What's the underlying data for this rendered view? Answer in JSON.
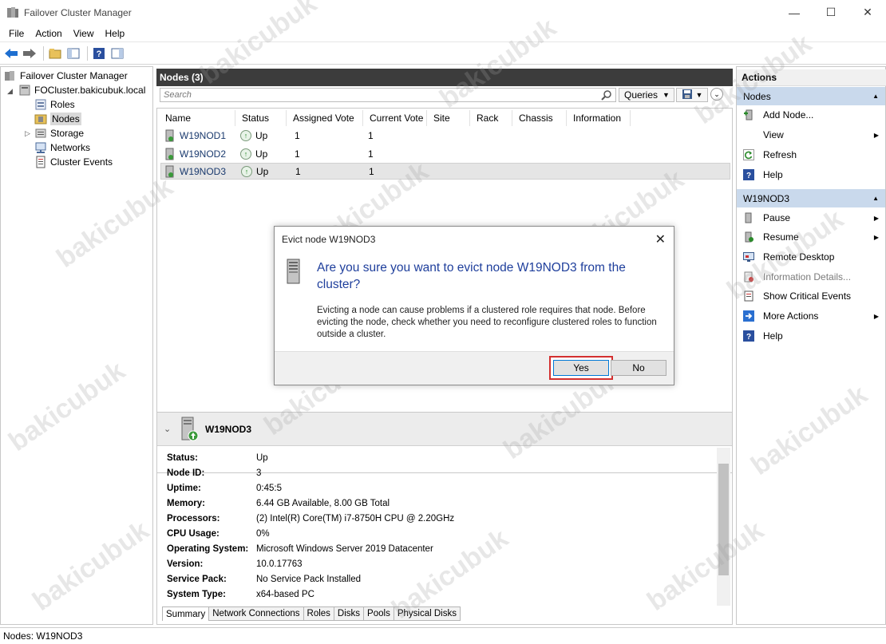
{
  "window": {
    "title": "Failover Cluster Manager",
    "minimize": "—",
    "maximize": "☐",
    "close": "✕"
  },
  "menu": [
    "File",
    "Action",
    "View",
    "Help"
  ],
  "tree": {
    "root": "Failover Cluster Manager",
    "cluster": "FOCluster.bakicubuk.local",
    "items": [
      "Roles",
      "Nodes",
      "Storage",
      "Networks",
      "Cluster Events"
    ]
  },
  "center": {
    "header": "Nodes (3)",
    "search_placeholder": "Search",
    "queries_label": "Queries",
    "columns": [
      "Name",
      "Status",
      "Assigned Vote",
      "Current Vote",
      "Site",
      "Rack",
      "Chassis",
      "Information"
    ],
    "rows": [
      {
        "name": "W19NOD1",
        "status": "Up",
        "assigned_vote": "1",
        "current_vote": "1"
      },
      {
        "name": "W19NOD2",
        "status": "Up",
        "assigned_vote": "1",
        "current_vote": "1"
      },
      {
        "name": "W19NOD3",
        "status": "Up",
        "assigned_vote": "1",
        "current_vote": "1"
      }
    ]
  },
  "details": {
    "title": "W19NOD3",
    "props": [
      {
        "k": "Status:",
        "v": "Up"
      },
      {
        "k": "Node ID:",
        "v": "3"
      },
      {
        "k": "Uptime:",
        "v": "0:45:5"
      },
      {
        "k": "Memory:",
        "v": "6.44 GB Available, 8.00 GB Total"
      },
      {
        "k": "Processors:",
        "v": "(2) Intel(R) Core(TM) i7-8750H CPU @ 2.20GHz"
      },
      {
        "k": "CPU Usage:",
        "v": "0%"
      },
      {
        "k": "Operating System:",
        "v": "Microsoft Windows Server 2019 Datacenter"
      },
      {
        "k": "Version:",
        "v": "10.0.17763"
      },
      {
        "k": "Service Pack:",
        "v": "No Service Pack Installed"
      },
      {
        "k": "System Type:",
        "v": "x64-based PC"
      }
    ],
    "tabs": [
      "Summary",
      "Network Connections",
      "Roles",
      "Disks",
      "Pools",
      "Physical Disks"
    ]
  },
  "actions": {
    "title": "Actions",
    "group1": "Nodes",
    "group1_items": [
      "Add Node...",
      "View",
      "Refresh",
      "Help"
    ],
    "group2": "W19NOD3",
    "group2_items": [
      "Pause",
      "Resume",
      "Remote Desktop",
      "Information Details...",
      "Show Critical Events",
      "More Actions",
      "Help"
    ]
  },
  "status_bar": "Nodes:  W19NOD3",
  "dialog": {
    "title": "Evict node W19NOD3",
    "question": "Are you sure you want to evict node W19NOD3 from the cluster?",
    "description": "Evicting a node can cause problems if a clustered role requires that node.  Before evicting the node, check whether you need to reconfigure clustered roles to function outside a cluster.",
    "yes": "Yes",
    "no": "No",
    "close": "✕"
  },
  "watermark": "bakicubuk"
}
